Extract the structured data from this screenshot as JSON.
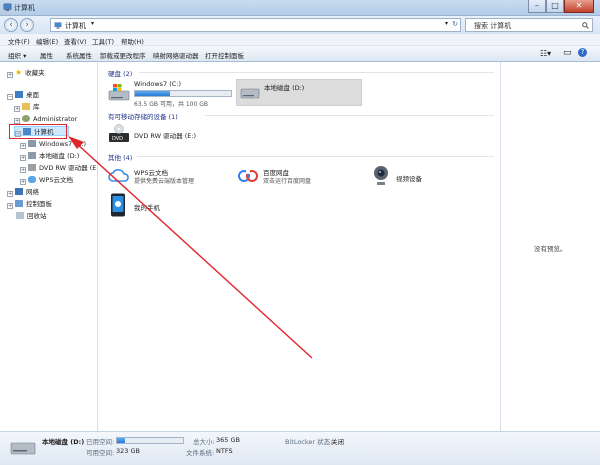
{
  "window": {
    "title": "计算机",
    "controls": [
      "–",
      "□",
      "✕"
    ]
  },
  "address": {
    "path": "计算机",
    "search_placeholder": "搜索 计算机"
  },
  "menu": [
    "文件(F)",
    "编辑(E)",
    "查看(V)",
    "工具(T)",
    "帮助(H)"
  ],
  "toolbar": [
    "组织 ▾",
    "属性",
    "系统属性",
    "卸载或更改程序",
    "映射网络驱动器",
    "打开控制面板"
  ],
  "nav": {
    "favorites": "收藏夹",
    "desktop": "桌面",
    "library": "库",
    "admin": "Administrator",
    "computer": "计算机",
    "win7": "Windows7 (C:)",
    "local_d": "本地磁盘 (D:)",
    "dvd": "DVD RW 驱动器 (E",
    "wps": "WPS云文档",
    "network": "网络",
    "control_panel": "控制面板",
    "recycle": "回收站"
  },
  "groups": {
    "hdd": "硬盘 (2)",
    "removable": "有可移动存储的设备 (1)",
    "other": "其他 (4)"
  },
  "drives": {
    "c": {
      "name": "Windows7 (C:)",
      "sub": "63.5 GB 可用，共 100 GB",
      "used_fraction": 0.365
    },
    "d": {
      "name": "本地磁盘 (D:)"
    }
  },
  "removable": {
    "dvd": "DVD RW 驱动器 (E:)"
  },
  "other": {
    "wps": {
      "name": "WPS云文档",
      "sub": "提供免费云端版本管理"
    },
    "baidu": {
      "name": "百度网盘",
      "sub": "双击运行百度网盘"
    },
    "camera": {
      "name": "视频设备"
    },
    "phone": {
      "name": "我的手机"
    }
  },
  "preview": {
    "empty": "没有预览。"
  },
  "details": {
    "name": "本地磁盘 (D:)",
    "used_label": "已用空间:",
    "free_label": "可用空间:",
    "free": "323 GB",
    "total_label": "总大小:",
    "total": "365 GB",
    "fs_label": "文件系统:",
    "fs": "NTFS",
    "bitlocker_label": "BitLocker 状态:",
    "bitlocker": "关闭",
    "used_fraction": 0.115
  },
  "colors": {
    "annotation": "#e0252d",
    "bar": "#2a7dd6",
    "selection": "#cde8ff"
  }
}
